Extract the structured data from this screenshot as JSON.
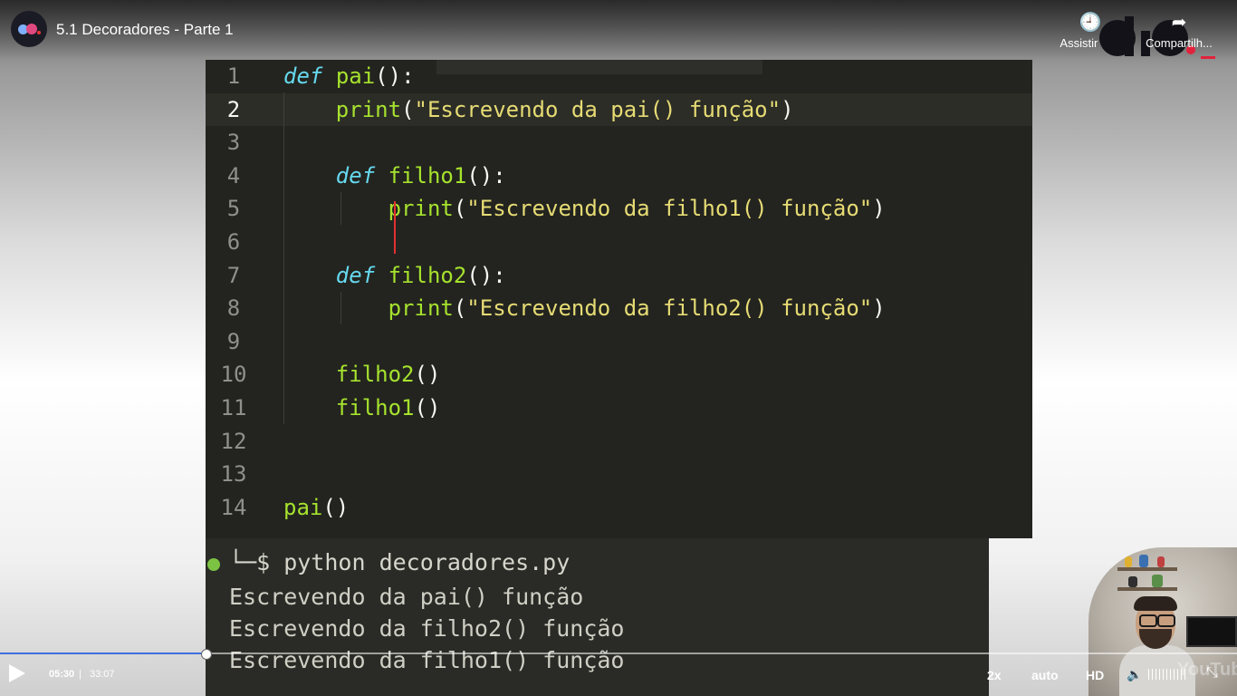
{
  "header": {
    "video_title": "5.1 Decoradores - Parte 1",
    "watch_later_label": "Assistir m...",
    "share_label": "Compartilh..."
  },
  "editor": {
    "active_line": 2,
    "lines": [
      {
        "n": "1",
        "tokens": [
          {
            "t": "def",
            "c": "kw"
          },
          {
            "t": " ",
            "c": "pn"
          },
          {
            "t": "pai",
            "c": "fn"
          },
          {
            "t": "():",
            "c": "pn"
          }
        ]
      },
      {
        "n": "2",
        "tokens": [
          {
            "t": "    ",
            "c": "pn"
          },
          {
            "t": "print",
            "c": "fn"
          },
          {
            "t": "(",
            "c": "pn"
          },
          {
            "t": "\"Escrevendo da pai() função\"",
            "c": "str"
          },
          {
            "t": ")",
            "c": "pn"
          }
        ]
      },
      {
        "n": "3",
        "tokens": []
      },
      {
        "n": "4",
        "tokens": [
          {
            "t": "    ",
            "c": "pn"
          },
          {
            "t": "def",
            "c": "kw"
          },
          {
            "t": " ",
            "c": "pn"
          },
          {
            "t": "filho1",
            "c": "fn"
          },
          {
            "t": "():",
            "c": "pn"
          }
        ]
      },
      {
        "n": "5",
        "tokens": [
          {
            "t": "        ",
            "c": "pn"
          },
          {
            "t": "print",
            "c": "fn"
          },
          {
            "t": "(",
            "c": "pn"
          },
          {
            "t": "\"Escrevendo da filho1() função\"",
            "c": "str"
          },
          {
            "t": ")",
            "c": "pn"
          }
        ]
      },
      {
        "n": "6",
        "tokens": []
      },
      {
        "n": "7",
        "tokens": [
          {
            "t": "    ",
            "c": "pn"
          },
          {
            "t": "def",
            "c": "kw"
          },
          {
            "t": " ",
            "c": "pn"
          },
          {
            "t": "filho2",
            "c": "fn"
          },
          {
            "t": "():",
            "c": "pn"
          }
        ]
      },
      {
        "n": "8",
        "tokens": [
          {
            "t": "        ",
            "c": "pn"
          },
          {
            "t": "print",
            "c": "fn"
          },
          {
            "t": "(",
            "c": "pn"
          },
          {
            "t": "\"Escrevendo da filho2() função\"",
            "c": "str"
          },
          {
            "t": ")",
            "c": "pn"
          }
        ]
      },
      {
        "n": "9",
        "tokens": []
      },
      {
        "n": "10",
        "tokens": [
          {
            "t": "    ",
            "c": "pn"
          },
          {
            "t": "filho2",
            "c": "fn"
          },
          {
            "t": "()",
            "c": "pn"
          }
        ]
      },
      {
        "n": "11",
        "tokens": [
          {
            "t": "    ",
            "c": "pn"
          },
          {
            "t": "filho1",
            "c": "fn"
          },
          {
            "t": "()",
            "c": "pn"
          }
        ]
      },
      {
        "n": "12",
        "tokens": []
      },
      {
        "n": "13",
        "tokens": []
      },
      {
        "n": "14",
        "tokens": [
          {
            "t": "pai",
            "c": "fn"
          },
          {
            "t": "()",
            "c": "pn"
          }
        ]
      }
    ]
  },
  "terminal": {
    "prompt": "└─$ python decoradores.py",
    "output": [
      "Escrevendo da pai() função",
      "Escrevendo da filho2() função",
      "Escrevendo da filho1() função"
    ]
  },
  "player": {
    "progress": 0.166,
    "current_time": "05:30",
    "separator": "|",
    "total_time": "33:07",
    "speed": "2x",
    "quality": "auto",
    "hd": "HD",
    "watermark": "YouTube"
  }
}
